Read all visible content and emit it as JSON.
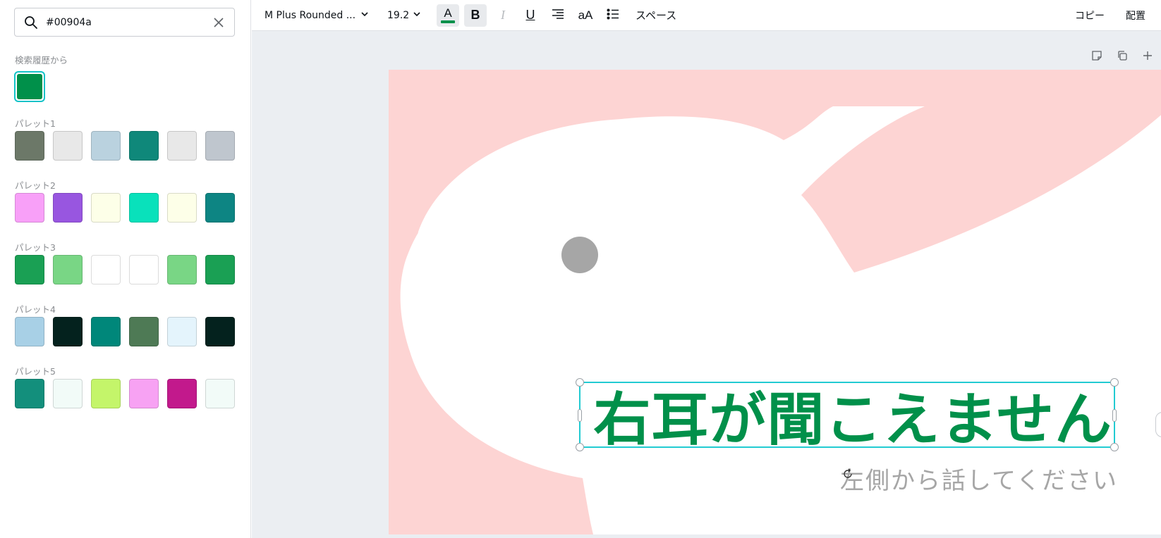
{
  "search": {
    "value": "#00904a",
    "placeholder": ""
  },
  "history": {
    "label": "検索履歴から",
    "colors": [
      "#00904a"
    ]
  },
  "palettes": [
    {
      "label": "パレット1",
      "colors": [
        "#6c7868",
        "#e8e8e8",
        "#bad2df",
        "#0f887a",
        "#e8e8e8",
        "#bfc6ce"
      ]
    },
    {
      "label": "パレット2",
      "colors": [
        "#f8a0f8",
        "#9856e0",
        "#fdffe8",
        "#09e1bb",
        "#fdffe8",
        "#0d8583"
      ]
    },
    {
      "label": "パレット3",
      "colors": [
        "#1aa054",
        "#79d685",
        "#ffffff",
        "#ffffff",
        "#79d685",
        "#1aa054"
      ]
    },
    {
      "label": "パレット4",
      "colors": [
        "#a8d0e6",
        "#04221e",
        "#00877a",
        "#4e7a55",
        "#e4f4fc",
        "#04221e"
      ]
    },
    {
      "label": "パレット5",
      "colors": [
        "#138f7c",
        "#f2fbf8",
        "#c4f56a",
        "#f7a2f3",
        "#c2198c",
        "#f2fbf8"
      ]
    }
  ],
  "toolbar": {
    "font": "M Plus Rounded ...",
    "size": "19.2",
    "text_color": "#00904a",
    "bold": "B",
    "italic": "I",
    "underline": "U",
    "case": "aA",
    "spacing": "スペース",
    "copy": "コピー",
    "arrange": "配置"
  },
  "canvas": {
    "headline": "右耳が聞こえません",
    "headline_color": "#00904a",
    "subtitle": "左側から話してください",
    "background_color": "#fdd4d3"
  }
}
